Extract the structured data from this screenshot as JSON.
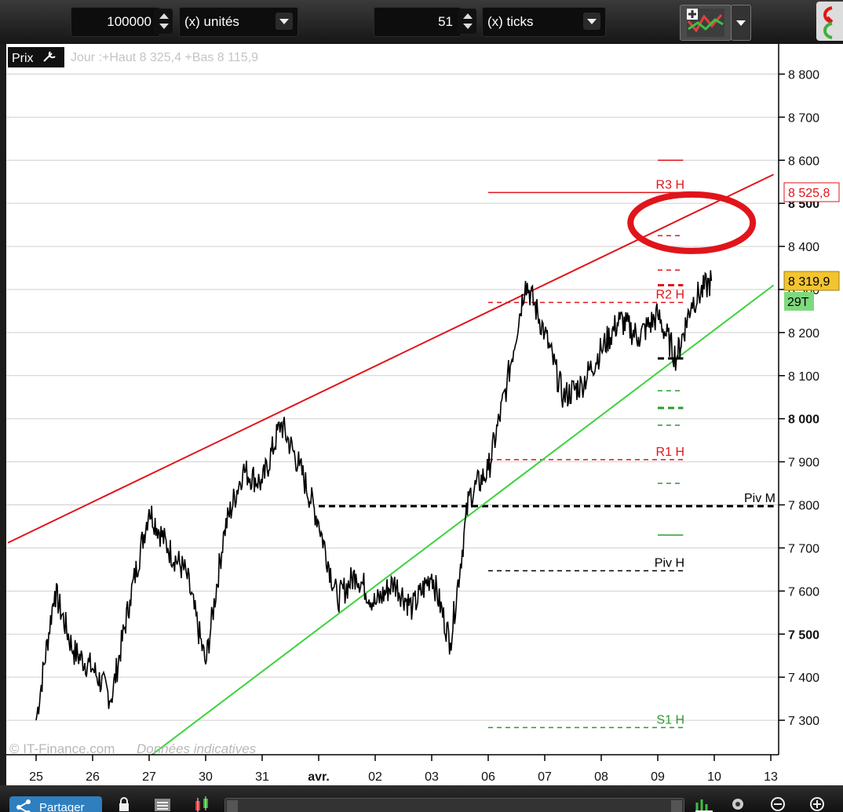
{
  "toolbar": {
    "quantity_value": "100000",
    "quantity_unit": "(x) unités",
    "ticks_value": "51",
    "ticks_unit": "(x) ticks",
    "indicator_icon": "indicator-chart-icon",
    "exit_icon": "red-arrows-icon"
  },
  "chart_header": {
    "label": "Prix",
    "info": "Jour :+Haut 8 325,4 +Bas 8 115,9"
  },
  "watermark": {
    "brand": "© IT-Finance.com",
    "note": "Données indicatives"
  },
  "price_tags": {
    "resistance": "8 525,8",
    "last": "8 319,9",
    "timer": "29T"
  },
  "colors": {
    "resistance": "#e0151b",
    "support": "#3cd43c",
    "price": "#000000",
    "last_tag": "#f3c431",
    "timer_tag": "#7ed97e",
    "share_button": "#2f7fbf"
  },
  "bottom": {
    "share_label": "Partager"
  },
  "chart_data": {
    "type": "line",
    "title": "",
    "ylim": [
      7220,
      8870
    ],
    "y_ticks": [
      {
        "value": 8800,
        "label": "8 800",
        "bold": false
      },
      {
        "value": 8700,
        "label": "8 700",
        "bold": false
      },
      {
        "value": 8600,
        "label": "8 600",
        "bold": false
      },
      {
        "value": 8500,
        "label": "8 500",
        "bold": true
      },
      {
        "value": 8400,
        "label": "8 400",
        "bold": false
      },
      {
        "value": 8300,
        "label": "8 300",
        "bold": false
      },
      {
        "value": 8200,
        "label": "8 200",
        "bold": false
      },
      {
        "value": 8100,
        "label": "8 100",
        "bold": false
      },
      {
        "value": 8000,
        "label": "8 000",
        "bold": true
      },
      {
        "value": 7900,
        "label": "7 900",
        "bold": false
      },
      {
        "value": 7800,
        "label": "7 800",
        "bold": false
      },
      {
        "value": 7700,
        "label": "7 700",
        "bold": false
      },
      {
        "value": 7600,
        "label": "7 600",
        "bold": false
      },
      {
        "value": 7500,
        "label": "7 500",
        "bold": true
      },
      {
        "value": 7400,
        "label": "7 400",
        "bold": false
      },
      {
        "value": 7300,
        "label": "7 300",
        "bold": false
      }
    ],
    "x_labels": [
      "25",
      "26",
      "27",
      "30",
      "31",
      "avr.",
      "02",
      "03",
      "06",
      "07",
      "08",
      "09",
      "10",
      "13"
    ],
    "series": [
      {
        "x": [
          0,
          0.33,
          0.66,
          1.0,
          1.33,
          1.66,
          2.0,
          2.33,
          2.66,
          3.0,
          3.33,
          3.66,
          4.0,
          4.33,
          4.66,
          5.0,
          5.33,
          5.66,
          6.0,
          6.33,
          6.66,
          7.0,
          7.33,
          7.66,
          8.0,
          8.33,
          8.66,
          9.0,
          9.33,
          9.66,
          10.0,
          10.33,
          10.66,
          11.0,
          11.33,
          11.6,
          11.95
        ],
        "values": [
          7300,
          7600,
          7460,
          7420,
          7350,
          7580,
          7790,
          7700,
          7640,
          7430,
          7740,
          7880,
          7850,
          7990,
          7890,
          7760,
          7580,
          7640,
          7570,
          7620,
          7560,
          7640,
          7480,
          7820,
          7880,
          8080,
          8320,
          8200,
          8050,
          8080,
          8160,
          8230,
          8190,
          8240,
          8140,
          8270,
          8320
        ]
      }
    ],
    "trendlines": [
      {
        "name": "resistance",
        "color": "#e0151b",
        "from": [
          -0.5,
          7712
        ],
        "to": [
          13.05,
          8567
        ]
      },
      {
        "name": "support",
        "color": "#3cd43c",
        "from": [
          2.05,
          7220
        ],
        "to": [
          13.05,
          8310
        ]
      }
    ],
    "levels": [
      {
        "label": "R3 H",
        "value": 8525,
        "color": "#e0151b",
        "style": "solid",
        "x0": 8.0,
        "x1": 11.5
      },
      {
        "label": "R2 H",
        "value": 8270,
        "color": "#e0151b",
        "style": "dashed",
        "x0": 8.0,
        "x1": 11.5
      },
      {
        "label": "R1 H",
        "value": 7905,
        "color": "#e0151b",
        "style": "dashed",
        "x0": 8.0,
        "x1": 11.5
      },
      {
        "label": "Piv M",
        "value": 7797,
        "color": "#000000",
        "style": "dashed-bold",
        "x0": 5.0,
        "x1": 13.05
      },
      {
        "label": "Piv H",
        "value": 7647,
        "color": "#000000",
        "style": "dashed",
        "x0": 8.0,
        "x1": 11.5
      },
      {
        "label": "S1 H",
        "value": 7283,
        "color": "#2e9a2e",
        "style": "dashed",
        "x0": 8.0,
        "x1": 11.5
      }
    ],
    "daily_marks": [
      {
        "value": 8600,
        "color": "#e0151b",
        "style": "solid"
      },
      {
        "value": 8425,
        "color": "#e0151b",
        "style": "dashed"
      },
      {
        "value": 8345,
        "color": "#e0151b",
        "style": "dashed"
      },
      {
        "value": 8310,
        "color": "#e0151b",
        "style": "dashed-bold"
      },
      {
        "value": 8140,
        "color": "#000000",
        "style": "dashed-bold"
      },
      {
        "value": 8065,
        "color": "#2e9a2e",
        "style": "dashed"
      },
      {
        "value": 8025,
        "color": "#2e9a2e",
        "style": "dashed-bold"
      },
      {
        "value": 7985,
        "color": "#2e9a2e",
        "style": "dashed"
      },
      {
        "value": 7850,
        "color": "#2e9a2e",
        "style": "dashed"
      },
      {
        "value": 7730,
        "color": "#2e9a2e",
        "style": "solid"
      }
    ],
    "highlight": {
      "shape": "ellipse",
      "color": "#e0151b",
      "x": 11.6,
      "y": 8455
    },
    "grid": true
  }
}
